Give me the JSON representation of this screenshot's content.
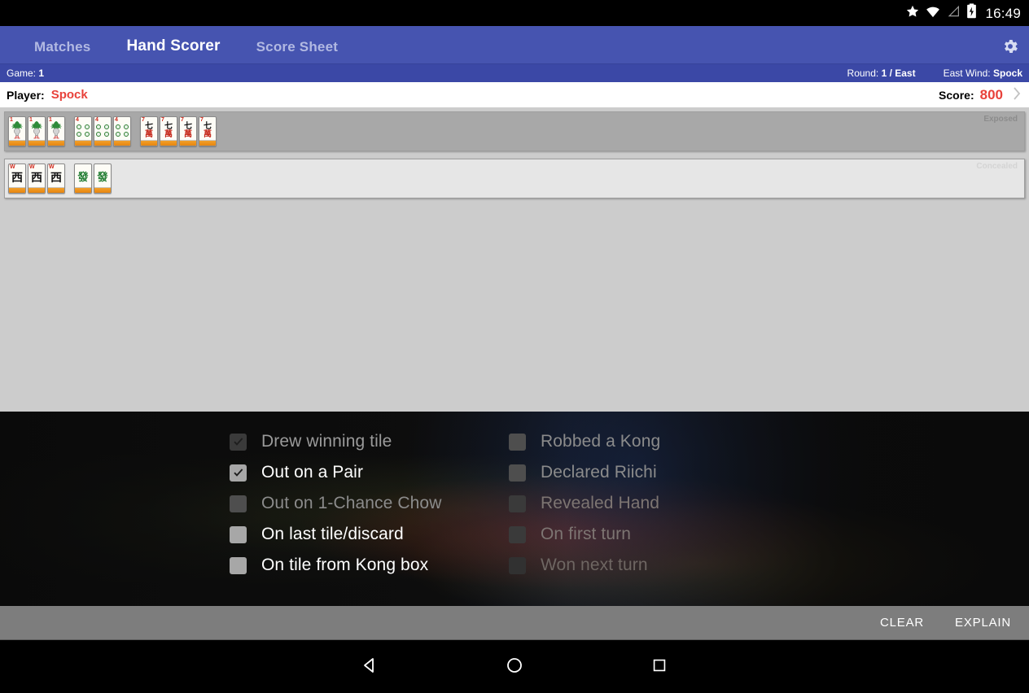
{
  "statusbar": {
    "time": "16:49",
    "icons": [
      "star-icon",
      "wifi-icon",
      "cell-signal-icon",
      "battery-charging-icon"
    ]
  },
  "appbar": {
    "tabs": [
      {
        "label": "Matches",
        "active": false
      },
      {
        "label": "Hand Scorer",
        "active": true
      },
      {
        "label": "Score Sheet",
        "active": false
      }
    ],
    "settings_icon": "gear-icon",
    "background_color": "#4654b0"
  },
  "gameinfo": {
    "game_label": "Game:",
    "game_value": "1",
    "round_label": "Round:",
    "round_value": "1 / East",
    "eastwind_label": "East Wind:",
    "eastwind_value": "Spock"
  },
  "playerbar": {
    "player_label": "Player:",
    "player_name": "Spock",
    "score_label": "Score:",
    "score_value": "800",
    "chevron_icon": "chevron-right-icon",
    "accent_color": "#e8413a"
  },
  "hand": {
    "exposed": {
      "label": "Exposed",
      "groups": [
        {
          "name": "bamboo-1-pung",
          "tiles": [
            {
              "kind": "bamboo",
              "corner": "1",
              "glyph": "bird"
            },
            {
              "kind": "bamboo",
              "corner": "1",
              "glyph": "bird"
            },
            {
              "kind": "bamboo",
              "corner": "1",
              "glyph": "bird"
            }
          ]
        },
        {
          "name": "dots-4-pung",
          "tiles": [
            {
              "kind": "dots",
              "corner": "4",
              "glyph": "4-dots"
            },
            {
              "kind": "dots",
              "corner": "4",
              "glyph": "4-dots"
            },
            {
              "kind": "dots",
              "corner": "4",
              "glyph": "4-dots"
            }
          ]
        },
        {
          "name": "characters-7-kong",
          "tiles": [
            {
              "kind": "characters",
              "corner": "7",
              "top": "七",
              "bottom": "萬"
            },
            {
              "kind": "characters",
              "corner": "7",
              "top": "七",
              "bottom": "萬"
            },
            {
              "kind": "characters",
              "corner": "7",
              "top": "七",
              "bottom": "萬"
            },
            {
              "kind": "characters",
              "corner": "7",
              "top": "七",
              "bottom": "萬"
            }
          ]
        }
      ]
    },
    "concealed": {
      "label": "Concealed",
      "groups": [
        {
          "name": "west-wind-pung",
          "tiles": [
            {
              "kind": "wind",
              "corner": "W",
              "glyph": "西"
            },
            {
              "kind": "wind",
              "corner": "W",
              "glyph": "西"
            },
            {
              "kind": "wind",
              "corner": "W",
              "glyph": "西"
            }
          ]
        },
        {
          "name": "green-dragon-pair",
          "tiles": [
            {
              "kind": "dragon",
              "corner": "",
              "glyph": "發"
            },
            {
              "kind": "dragon",
              "corner": "",
              "glyph": "發"
            }
          ]
        }
      ]
    }
  },
  "flags": {
    "left_column": [
      {
        "label": "Drew winning tile",
        "checked": true,
        "enabled": false
      },
      {
        "label": "Out on a Pair",
        "checked": true,
        "enabled": true
      },
      {
        "label": "Out on 1-Chance Chow",
        "checked": false,
        "enabled": false
      },
      {
        "label": "On last tile/discard",
        "checked": false,
        "enabled": true
      },
      {
        "label": "On tile from Kong box",
        "checked": false,
        "enabled": true
      }
    ],
    "right_column": [
      {
        "label": "Robbed a Kong",
        "checked": false,
        "enabled": false
      },
      {
        "label": "Declared Riichi",
        "checked": false,
        "enabled": false
      },
      {
        "label": "Revealed Hand",
        "checked": false,
        "enabled": false
      },
      {
        "label": "On first turn",
        "checked": false,
        "enabled": false
      },
      {
        "label": "Won next turn",
        "checked": false,
        "enabled": false
      }
    ]
  },
  "actionbar": {
    "clear_label": "CLEAR",
    "explain_label": "EXPLAIN"
  },
  "navbar": {
    "back_icon": "back-triangle-icon",
    "home_icon": "home-circle-icon",
    "recents_icon": "recents-square-icon"
  }
}
